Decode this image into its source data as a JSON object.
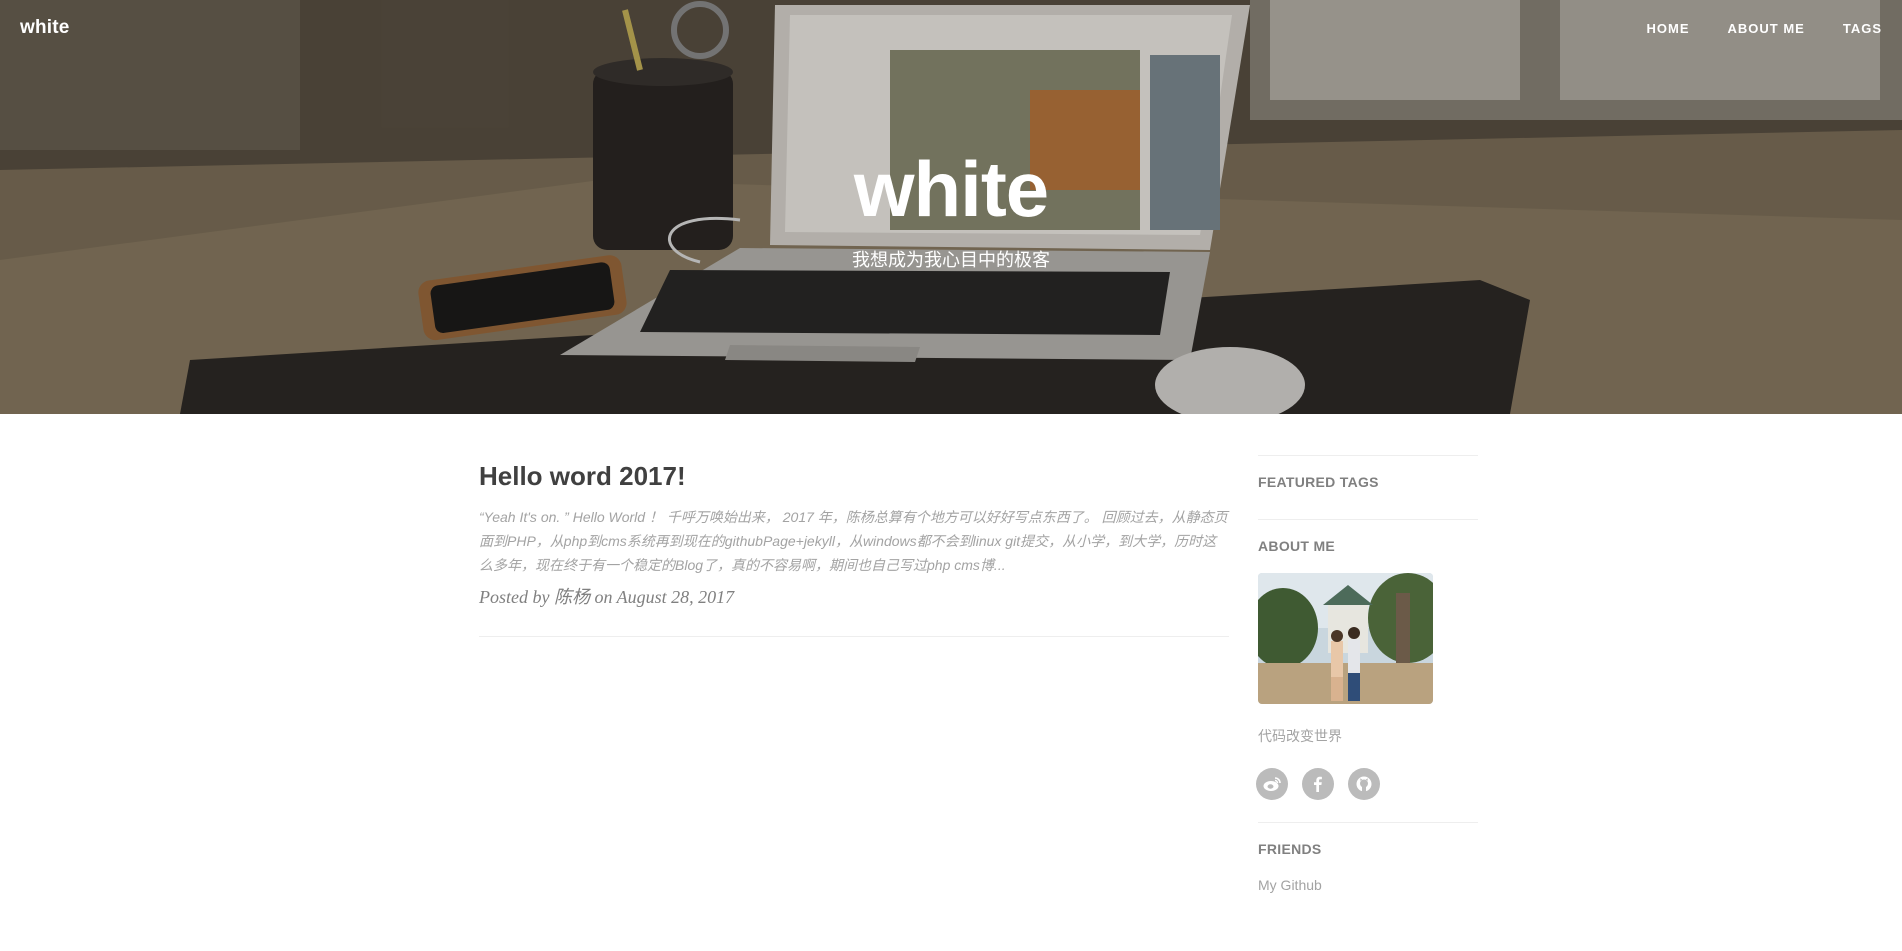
{
  "header": {
    "brand": "white",
    "nav": [
      {
        "label": "HOME"
      },
      {
        "label": "ABOUT ME"
      },
      {
        "label": "TAGS"
      }
    ],
    "title": "white",
    "subtitle": "我想成为我心目中的极客"
  },
  "posts": [
    {
      "title": "Hello word 2017!",
      "excerpt": "“Yeah It's on. ” Hello World ！ 千呼万唤始出来， 2017 年，陈杨总算有个地方可以好好写点东西了。 回顾过去，从静态页面到PHP，从php到cms系统再到现在的githubPage+jekyll，从windows都不会到linux git提交，从小学，到大学，历时这么多年，现在终于有一个稳定的Blog了，真的不容易啊，期间也自己写过php cms博...",
      "meta_prefix": "Posted by",
      "author": "陈杨",
      "meta_on": "on",
      "date": "August 28, 2017"
    }
  ],
  "sidebar": {
    "featured_tags_title": "FEATURED TAGS",
    "about_title": "ABOUT ME",
    "about_text": "代码改变世界",
    "socials": [
      {
        "icon": "weibo-icon"
      },
      {
        "icon": "facebook-icon"
      },
      {
        "icon": "github-icon"
      }
    ],
    "friends_title": "FRIENDS",
    "friends": [
      {
        "label": "My Github"
      }
    ]
  },
  "colors": {
    "text": "#404040",
    "muted": "#a3a3a3",
    "meta": "#808080",
    "social_bg": "#bbbbbb",
    "divider": "#eeeeee"
  }
}
